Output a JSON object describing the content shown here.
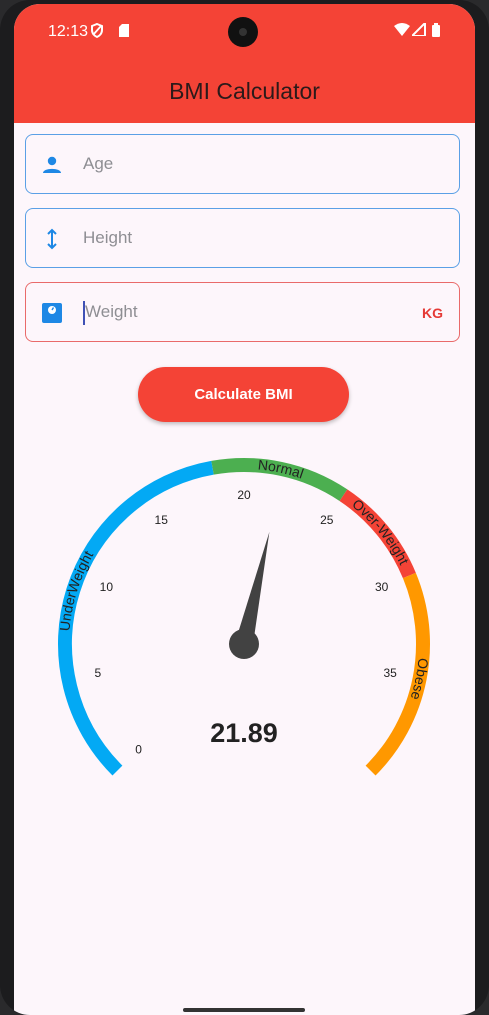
{
  "status": {
    "time": "12:13"
  },
  "app": {
    "title": "BMI Calculator"
  },
  "form": {
    "age": {
      "placeholder": "Age",
      "icon": "person-icon"
    },
    "height": {
      "placeholder": "Height",
      "icon": "vertical-arrows-icon"
    },
    "weight": {
      "placeholder": "Weight",
      "suffix": "KG",
      "icon": "scale-icon"
    }
  },
  "calculate_button": {
    "label": "Calculate BMI"
  },
  "gauge": {
    "value": 21.89,
    "value_label": "21.89",
    "range": [
      0,
      40
    ],
    "ticks": [
      0,
      5,
      10,
      15,
      20,
      25,
      30,
      35
    ],
    "segments": [
      {
        "name": "UnderWeight",
        "from": 0,
        "to": 18.5,
        "color": "#03a9f4"
      },
      {
        "name": "Normal",
        "from": 18.5,
        "to": 25,
        "color": "#4caf50"
      },
      {
        "name": "Over-Weight",
        "from": 25,
        "to": 30,
        "color": "#f44336"
      },
      {
        "name": "Obese",
        "from": 30,
        "to": 40,
        "color": "#ff9800"
      }
    ]
  },
  "colors": {
    "accent": "#f44336",
    "input_border": "#5aa0e6",
    "needle": "#424242"
  }
}
